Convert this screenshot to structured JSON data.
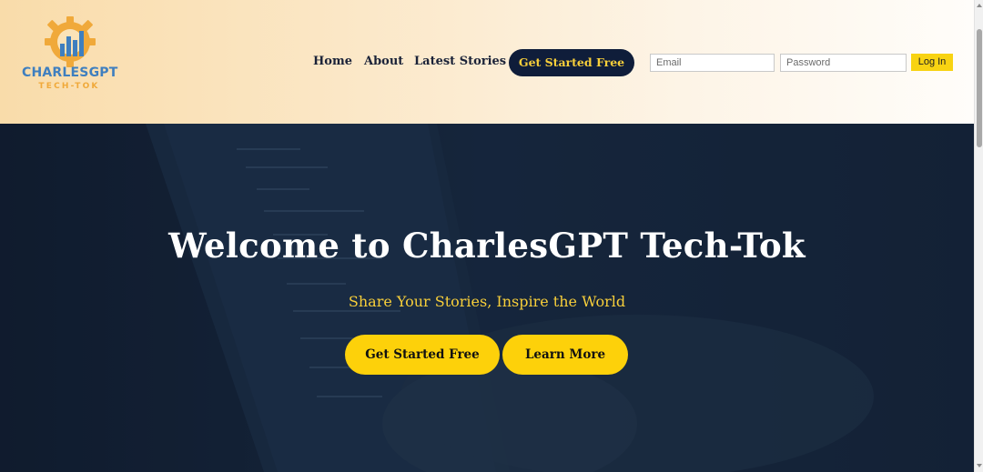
{
  "brand": {
    "name": "CHARLESGPT",
    "tagline": "TECH-TOK",
    "colors": {
      "blue": "#3f7fbf",
      "orange": "#f0a93a"
    }
  },
  "nav": {
    "links": [
      "Home",
      "About",
      "Latest Stories"
    ],
    "cta_label": "Get Started Free"
  },
  "login": {
    "email_placeholder": "Email",
    "password_placeholder": "Password",
    "button_label": "Log In"
  },
  "hero": {
    "title": "Welcome to CharlesGPT Tech-Tok",
    "subtitle": "Share Your Stories, Inspire the World",
    "primary_label": "Get Started Free",
    "secondary_label": "Learn More"
  },
  "colors": {
    "navy": "#0f1d3a",
    "yellow": "#fdd10a",
    "gold_text": "#f8cf3a"
  }
}
